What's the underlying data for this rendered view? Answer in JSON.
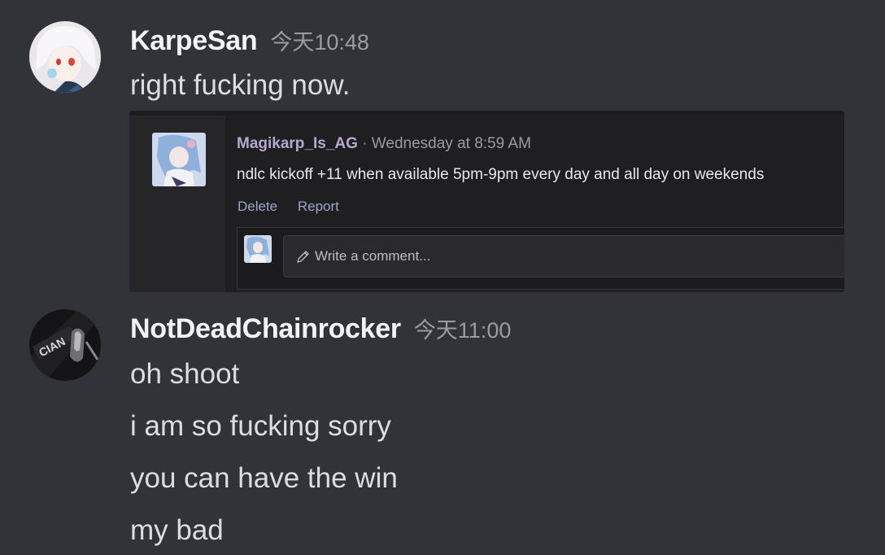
{
  "messages": [
    {
      "username": "KarpeSan",
      "timestamp": "今天10:48",
      "lines": [
        "right fucking now."
      ],
      "embed": {
        "author": "Magikarp_Is_AG",
        "separator": "·",
        "date": "Wednesday at 8:59 AM",
        "text": "ndlc kickoff +11 when available 5pm-9pm every day and all day on weekends",
        "actions": [
          "Delete",
          "Report"
        ],
        "comment_placeholder": "Write a comment..."
      }
    },
    {
      "username": "NotDeadChainrocker",
      "timestamp": "今天11:00",
      "lines": [
        "oh shoot",
        "i am so fucking sorry",
        "you can have the win",
        "my bad"
      ]
    }
  ],
  "colors": {
    "background": "#323339",
    "username": "#f2f3f5",
    "timestamp": "#9a9ca2",
    "message_text": "#dcdde1",
    "embed_author": "#b7a8cf",
    "embed_action": "#9aa6c9"
  },
  "icons": {
    "comment_icon": "pencil-icon"
  }
}
